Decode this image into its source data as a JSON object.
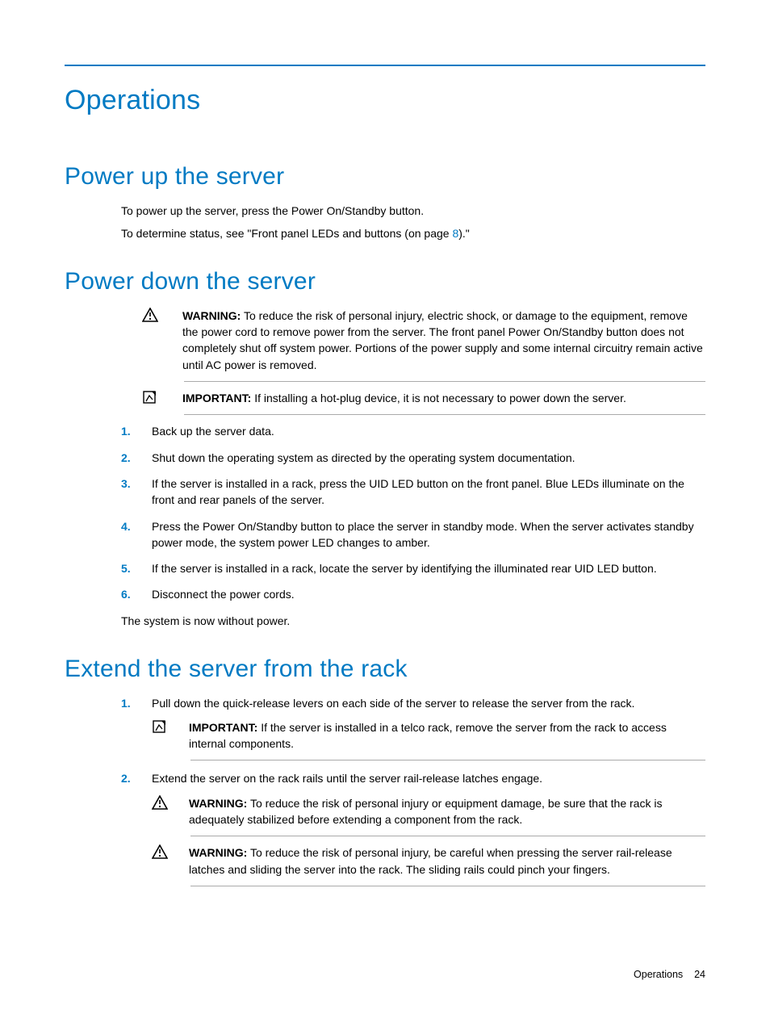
{
  "title": "Operations",
  "sections": {
    "power_up": {
      "heading": "Power up the server",
      "p1": "To power up the server, press the Power On/Standby button.",
      "p2a": "To determine status, see \"Front panel LEDs and buttons (on page ",
      "p2link": "8",
      "p2b": ").\""
    },
    "power_down": {
      "heading": "Power down the server",
      "warn_label": "WARNING:",
      "warn_text": "To reduce the risk of personal injury, electric shock, or damage to the equipment, remove the power cord to remove power from the server. The front panel Power On/Standby button does not completely shut off system power. Portions of the power supply and some internal circuitry remain active until AC power is removed.",
      "imp_label": "IMPORTANT:",
      "imp_text": "If installing a hot-plug device, it is not necessary to power down the server.",
      "steps": [
        "Back up the server data.",
        "Shut down the operating system as directed by the operating system documentation.",
        "If the server is installed in a rack, press the UID LED button on the front panel. Blue LEDs illuminate on the front and rear panels of the server.",
        "Press the Power On/Standby button to place the server in standby mode. When the server activates standby power mode, the system power LED changes to amber.",
        "If the server is installed in a rack, locate the server by identifying the illuminated rear UID LED button.",
        "Disconnect the power cords."
      ],
      "closing": "The system is now without power."
    },
    "extend": {
      "heading": "Extend the server from the rack",
      "step1": "Pull down the quick-release levers on each side of the server to release the server from the rack.",
      "step1_imp_label": "IMPORTANT:",
      "step1_imp_text": "If the server is installed in a telco rack, remove the server from the rack to access internal components.",
      "step2": "Extend the server on the rack rails until the server rail-release latches engage.",
      "step2_warn1_label": "WARNING:",
      "step2_warn1_text": "To reduce the risk of personal injury or equipment damage, be sure that the rack is adequately stabilized before extending a component from the rack.",
      "step2_warn2_label": "WARNING:",
      "step2_warn2_text": "To reduce the risk of personal injury, be careful when pressing the server rail-release latches and sliding the server into the rack. The sliding rails could pinch your fingers."
    }
  },
  "footer": {
    "label": "Operations",
    "page": "24"
  }
}
